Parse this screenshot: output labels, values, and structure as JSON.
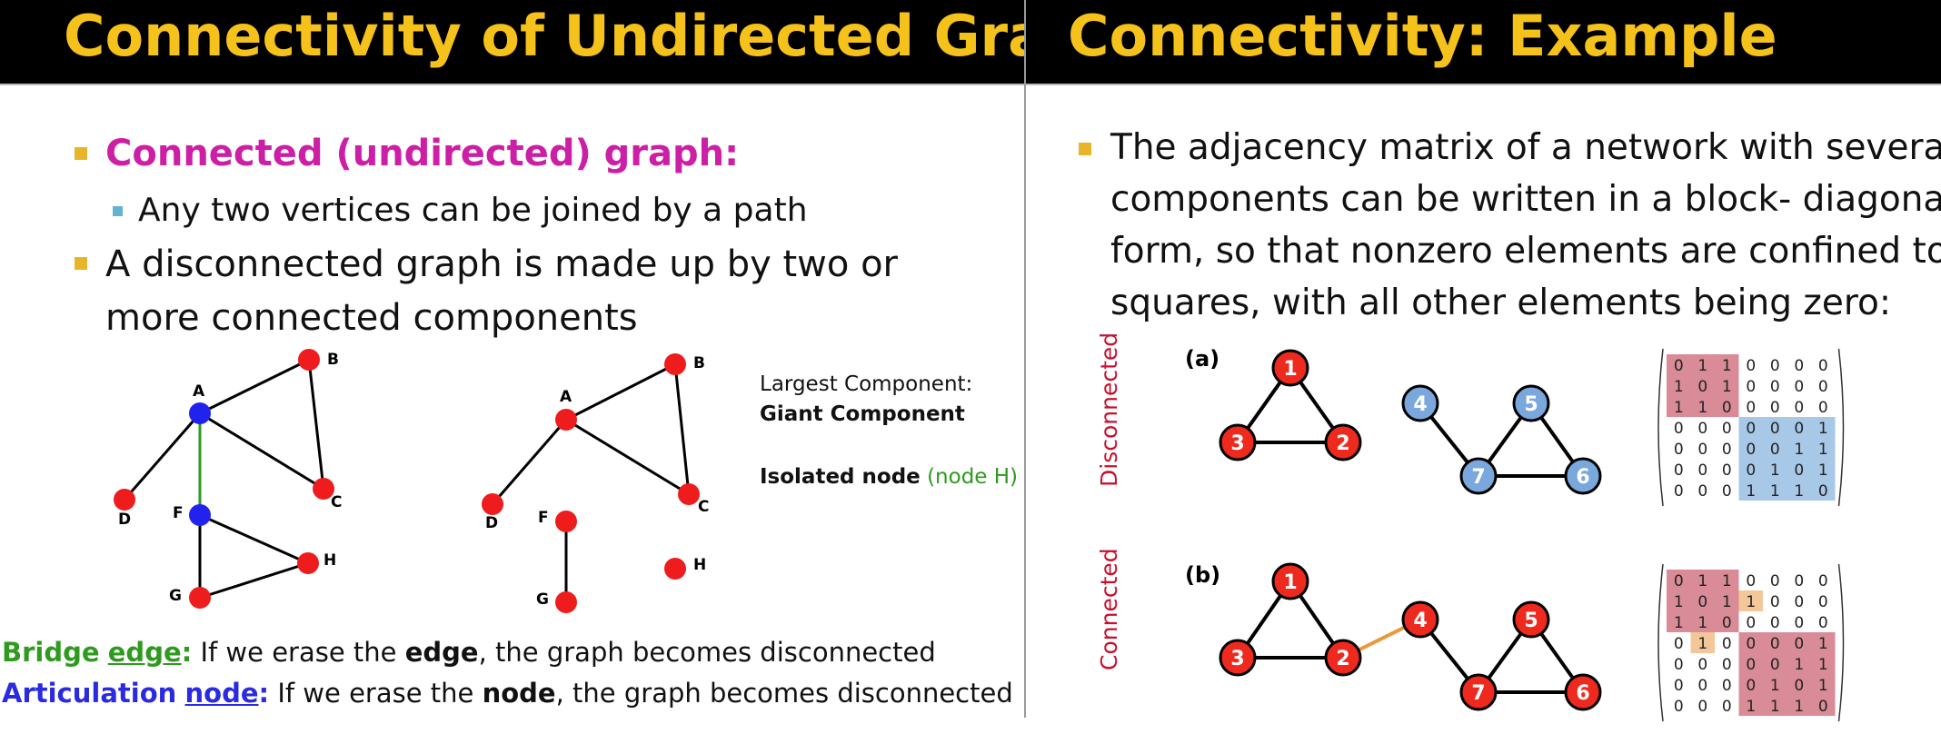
{
  "left_slide": {
    "title": "Connectivity of Undirected Graphs",
    "bullet1": "Connected (undirected) graph:",
    "sub_bullet1": "Any two vertices can be joined by a path",
    "bullet2_line1": "A disconnected graph is made up by two or",
    "bullet2_line2": "more connected components",
    "graph1_labels": {
      "A": "A",
      "B": "B",
      "C": "C",
      "D": "D",
      "F": "F",
      "G": "G",
      "H": "H"
    },
    "graph2_labels": {
      "A": "A",
      "B": "B",
      "C": "C",
      "D": "D",
      "F": "F",
      "G": "G",
      "H": "H"
    },
    "largest_component_label": "Largest Component:",
    "giant_component_label": "Giant Component",
    "isolated_node_label": "Isolated node",
    "isolated_node_note": "(node H)",
    "bridge_term": "Bridge",
    "bridge_term_underlined": "edge",
    "bridge_colon": ":",
    "bridge_text_pre": " If we erase the ",
    "bridge_text_bold": "edge",
    "bridge_text_post": ", the graph becomes disconnected",
    "articulation_term": "Articulation",
    "articulation_term_underlined": "node",
    "articulation_colon": ":",
    "articulation_text_pre": " If we erase the ",
    "articulation_text_bold": "node",
    "articulation_text_post": ", the graph becomes disconnected",
    "colors": {
      "title": "#f5c21b",
      "magenta": "#cc1fa6",
      "red_node": "#ee1c1c",
      "blue_node": "#2222ee",
      "bridge_green": "#2e9a1e",
      "articulation_blue": "#2a2ae0",
      "isolated_green": "#2e9a1e"
    }
  },
  "right_slide": {
    "title": "Connectivity: Example",
    "bullet_lines": [
      "The adjacency matrix of a network with several",
      "components can be written in a block- diagonal",
      "form, so that nonzero elements are confined to",
      "squares, with all other elements being zero:"
    ],
    "panel_a_label": "(a)",
    "panel_b_label": "(b)",
    "side_label_a": "Disconnected",
    "side_label_b": "Connected",
    "node_labels": [
      "1",
      "2",
      "3",
      "4",
      "5",
      "6",
      "7"
    ],
    "matrix_a": [
      [
        "0",
        "1",
        "1",
        "0",
        "0",
        "0",
        "0"
      ],
      [
        "1",
        "0",
        "1",
        "0",
        "0",
        "0",
        "0"
      ],
      [
        "1",
        "1",
        "0",
        "0",
        "0",
        "0",
        "0"
      ],
      [
        "0",
        "0",
        "0",
        "0",
        "0",
        "0",
        "1"
      ],
      [
        "0",
        "0",
        "0",
        "0",
        "0",
        "1",
        "1"
      ],
      [
        "0",
        "0",
        "0",
        "0",
        "1",
        "0",
        "1"
      ],
      [
        "0",
        "0",
        "0",
        "1",
        "1",
        "1",
        "0"
      ]
    ],
    "matrix_b": [
      [
        "0",
        "1",
        "1",
        "0",
        "0",
        "0",
        "0"
      ],
      [
        "1",
        "0",
        "1",
        "1",
        "0",
        "0",
        "0"
      ],
      [
        "1",
        "1",
        "0",
        "0",
        "0",
        "0",
        "0"
      ],
      [
        "0",
        "1",
        "0",
        "0",
        "0",
        "0",
        "1"
      ],
      [
        "0",
        "0",
        "0",
        "0",
        "0",
        "1",
        "1"
      ],
      [
        "0",
        "0",
        "0",
        "0",
        "1",
        "0",
        "1"
      ],
      [
        "0",
        "0",
        "0",
        "1",
        "1",
        "1",
        "0"
      ]
    ],
    "colors": {
      "red_node": "#ee2a1e",
      "blue_node": "#7aa7dc",
      "red_block": "#d98c97",
      "blue_block": "#a8c8e8",
      "orange_block": "#f4c79a",
      "orange_edge": "#e89a3a",
      "side_label": "#c8102e"
    }
  }
}
